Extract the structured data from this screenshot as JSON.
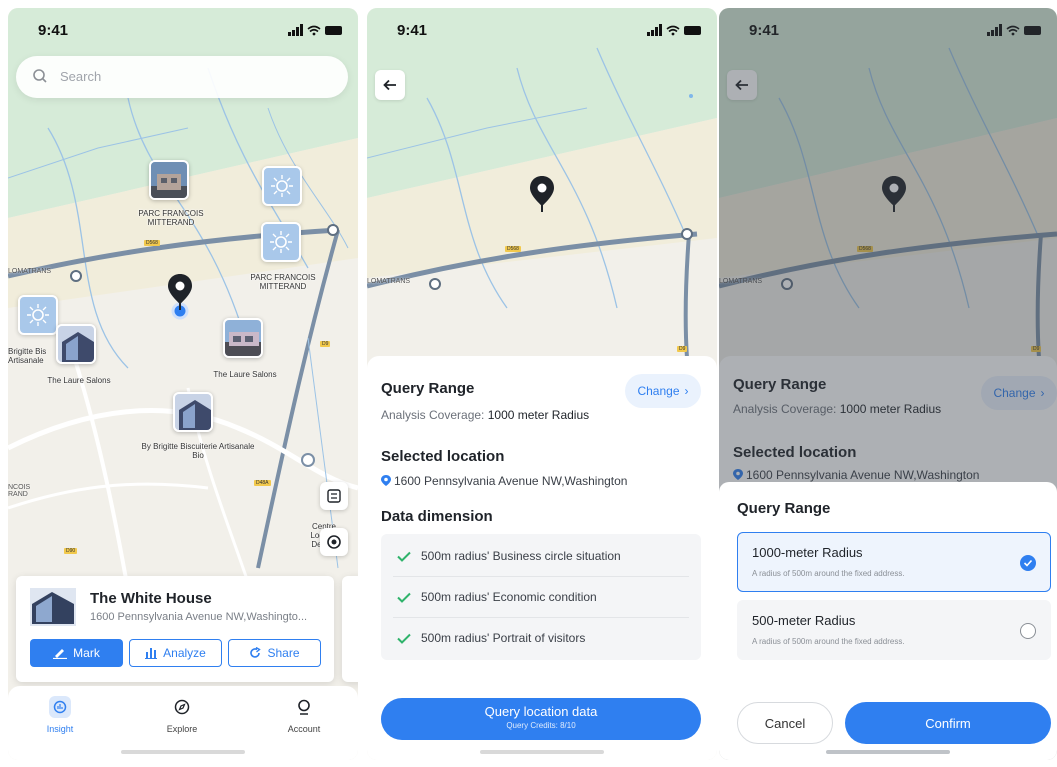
{
  "status": {
    "time": "9:41"
  },
  "screen1": {
    "search_placeholder": "Search",
    "pois": [
      {
        "label": "PARC FRANCOIS MITTERAND"
      },
      {
        "label": "PARC FRANCOIS MITTERAND"
      },
      {
        "label": "Brigitte Bis Artisanale"
      },
      {
        "label": "The Laure Salons"
      },
      {
        "label": "The Laure Salons"
      },
      {
        "label": "By Brigitte Biscuiterie Artisanale Bio"
      },
      {
        "label": "Centre Logistic Deca..."
      }
    ],
    "road_labels": [
      "LOMATRANS",
      "NCOIS RAND"
    ],
    "card": {
      "title": "The White House",
      "address": "1600 Pennsylvania Avenue NW,Washingto...",
      "mark": "Mark",
      "analyze": "Analyze",
      "share": "Share"
    },
    "tabs": [
      {
        "label": "Insight",
        "icon": "insight-icon",
        "active": true
      },
      {
        "label": "Explore",
        "icon": "compass-icon",
        "active": false
      },
      {
        "label": "Account",
        "icon": "user-icon",
        "active": false
      }
    ]
  },
  "screen2": {
    "road_label": "LOMATRANS",
    "query_range_title": "Query Range",
    "coverage_label": "Analysis Coverage:",
    "coverage_value": "1000 meter Radius",
    "change": "Change",
    "selected_title": "Selected location",
    "selected_address": "1600 Pennsylvania Avenue NW,Washington",
    "dimension_title": "Data dimension",
    "dimensions": [
      "500m radius' Business circle situation",
      "500m radius' Economic condition",
      "500m radius' Portrait of visitors"
    ],
    "query_button": "Query location data",
    "credits": "Query Credits: 8/10"
  },
  "screen3": {
    "road_label": "LOMATRANS",
    "query_range_title": "Query Range",
    "coverage_label": "Analysis Coverage:",
    "coverage_value": "1000 meter Radius",
    "change": "Change",
    "selected_title": "Selected location",
    "selected_address": "1600 Pennsylvania Avenue NW,Washington",
    "modal_title": "Query Range",
    "options": [
      {
        "title": "1000-meter Radius",
        "desc": "A radius of 500m around the fixed address.",
        "selected": true
      },
      {
        "title": "500-meter Radius",
        "desc": "A radius of 500m around the fixed address.",
        "selected": false
      }
    ],
    "cancel": "Cancel",
    "confirm": "Confirm"
  },
  "colors": {
    "accent": "#2f7ff0",
    "map_green": "#cfe9cf",
    "map_beige": "#f1eddd"
  }
}
